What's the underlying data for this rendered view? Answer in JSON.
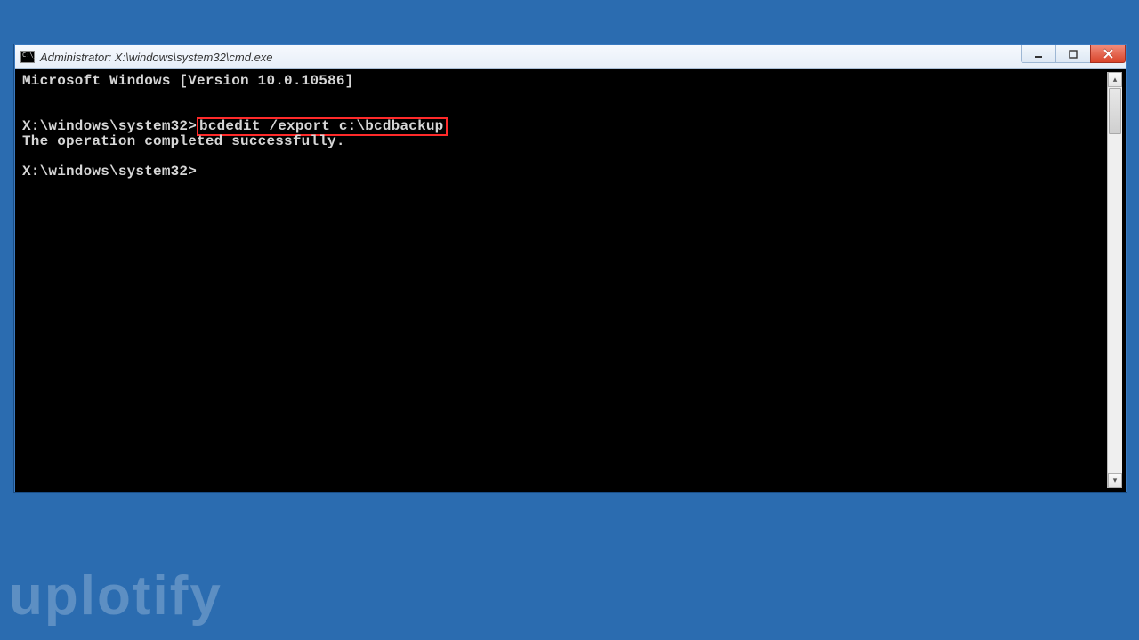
{
  "window": {
    "title": "Administrator: X:\\windows\\system32\\cmd.exe"
  },
  "console": {
    "version_line": "Microsoft Windows [Version 10.0.10586]",
    "prompt1": "X:\\windows\\system32>",
    "command1": "bcdedit /export c:\\bcdbackup",
    "result1": "The operation completed successfully.",
    "prompt2": "X:\\windows\\system32>"
  },
  "watermark": "uplotify",
  "scrollbar": {
    "up_glyph": "▴",
    "down_glyph": "▾"
  }
}
